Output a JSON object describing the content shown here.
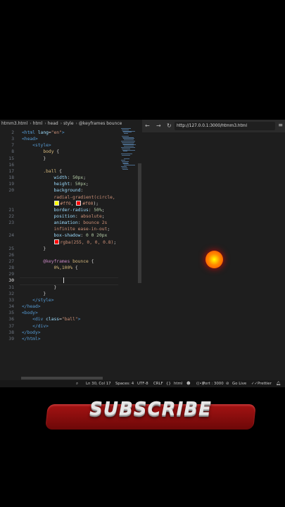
{
  "editor": {
    "breadcrumb": [
      "htmm3.html",
      "html",
      "head",
      "style",
      "@keyframes bounce"
    ],
    "lines": [
      {
        "n": "2",
        "segments": [
          [
            "tag",
            "<html "
          ],
          [
            "attr",
            "lang"
          ],
          [
            "plain",
            "="
          ],
          [
            "str",
            "\"en\""
          ],
          [
            "tag",
            ">"
          ]
        ]
      },
      {
        "n": "3",
        "segments": [
          [
            "tag",
            "<head>"
          ]
        ]
      },
      {
        "n": "7",
        "segments": [
          [
            "plain",
            "    "
          ],
          [
            "tag",
            "<style>"
          ]
        ]
      },
      {
        "n": "8",
        "segments": [
          [
            "plain",
            "        "
          ],
          [
            "sel",
            "body"
          ],
          [
            "plain",
            " {"
          ]
        ]
      },
      {
        "n": "15",
        "segments": [
          [
            "plain",
            "        }"
          ]
        ]
      },
      {
        "n": "16",
        "segments": [
          [
            "plain",
            ""
          ]
        ]
      },
      {
        "n": "17",
        "segments": [
          [
            "plain",
            "        "
          ],
          [
            "sel",
            ".ball"
          ],
          [
            "plain",
            " {"
          ]
        ]
      },
      {
        "n": "18",
        "segments": [
          [
            "plain",
            "            "
          ],
          [
            "prop",
            "width"
          ],
          [
            "plain",
            ": "
          ],
          [
            "num",
            "50px"
          ],
          [
            "plain",
            ";"
          ]
        ]
      },
      {
        "n": "19",
        "segments": [
          [
            "plain",
            "            "
          ],
          [
            "prop",
            "height"
          ],
          [
            "plain",
            ": "
          ],
          [
            "num",
            "50px"
          ],
          [
            "plain",
            ";"
          ]
        ]
      },
      {
        "n": "20",
        "segments": [
          [
            "plain",
            "            "
          ],
          [
            "prop",
            "background"
          ],
          [
            "plain",
            ":"
          ]
        ]
      },
      {
        "n": "",
        "segments": [
          [
            "plain",
            "            "
          ],
          [
            "val",
            "radial-gradient(circle,"
          ]
        ]
      },
      {
        "n": "",
        "segments": [
          [
            "plain",
            "            "
          ],
          [
            "swatchY",
            ""
          ],
          [
            "val",
            "#ff0"
          ],
          [
            "plain",
            ", "
          ],
          [
            "swatchR",
            ""
          ],
          [
            "val",
            "#f00"
          ],
          [
            "plain",
            ");"
          ]
        ]
      },
      {
        "n": "21",
        "segments": [
          [
            "plain",
            "            "
          ],
          [
            "prop",
            "border-radius"
          ],
          [
            "plain",
            ": "
          ],
          [
            "num",
            "50%"
          ],
          [
            "plain",
            ";"
          ]
        ]
      },
      {
        "n": "22",
        "segments": [
          [
            "plain",
            "            "
          ],
          [
            "prop",
            "position"
          ],
          [
            "plain",
            ": "
          ],
          [
            "val",
            "absolute"
          ],
          [
            "plain",
            ";"
          ]
        ]
      },
      {
        "n": "23",
        "segments": [
          [
            "plain",
            "            "
          ],
          [
            "prop",
            "animation"
          ],
          [
            "plain",
            ": "
          ],
          [
            "val",
            "bounce 2s"
          ]
        ]
      },
      {
        "n": "",
        "segments": [
          [
            "plain",
            "            "
          ],
          [
            "val",
            "infinite ease-in-out"
          ],
          [
            "plain",
            ";"
          ]
        ]
      },
      {
        "n": "24",
        "segments": [
          [
            "plain",
            "            "
          ],
          [
            "prop",
            "box-shadow"
          ],
          [
            "plain",
            ": "
          ],
          [
            "num",
            "0 0 20px"
          ]
        ]
      },
      {
        "n": "",
        "segments": [
          [
            "plain",
            "            "
          ],
          [
            "swatchR",
            ""
          ],
          [
            "val",
            "rgba(255, 0, 0, 0.8)"
          ],
          [
            "plain",
            ";"
          ]
        ]
      },
      {
        "n": "25",
        "segments": [
          [
            "plain",
            "        }"
          ]
        ]
      },
      {
        "n": "26",
        "segments": [
          [
            "plain",
            ""
          ]
        ]
      },
      {
        "n": "27",
        "segments": [
          [
            "plain",
            "        "
          ],
          [
            "kw",
            "@keyframes"
          ],
          [
            "plain",
            " "
          ],
          [
            "sel",
            "bounce"
          ],
          [
            "plain",
            " {"
          ]
        ]
      },
      {
        "n": "28",
        "segments": [
          [
            "plain",
            "            "
          ],
          [
            "sel",
            "0%,100%"
          ],
          [
            "plain",
            " {"
          ]
        ]
      },
      {
        "n": "29",
        "segments": [
          [
            "plain",
            ""
          ]
        ]
      },
      {
        "n": "30",
        "segments": [
          [
            "plain",
            ""
          ]
        ]
      },
      {
        "n": "31",
        "segments": [
          [
            "plain",
            "            }"
          ]
        ]
      },
      {
        "n": "32",
        "segments": [
          [
            "plain",
            "        }"
          ]
        ]
      },
      {
        "n": "33",
        "segments": [
          [
            "plain",
            "    "
          ],
          [
            "tag",
            "</style>"
          ]
        ]
      },
      {
        "n": "34",
        "segments": [
          [
            "tag",
            "</head>"
          ]
        ]
      },
      {
        "n": "35",
        "segments": [
          [
            "tag",
            "<body>"
          ]
        ]
      },
      {
        "n": "36",
        "segments": [
          [
            "plain",
            "    "
          ],
          [
            "tag",
            "<div "
          ],
          [
            "attr",
            "class"
          ],
          [
            "plain",
            "="
          ],
          [
            "str",
            "\"ball\""
          ],
          [
            "tag",
            ">"
          ]
        ]
      },
      {
        "n": "37",
        "segments": [
          [
            "plain",
            "    "
          ],
          [
            "tag",
            "</div>"
          ]
        ]
      },
      {
        "n": "38",
        "segments": [
          [
            "tag",
            "</body>"
          ]
        ]
      },
      {
        "n": "39",
        "segments": [
          [
            "tag",
            "</html>"
          ]
        ]
      }
    ],
    "active_line": "30"
  },
  "browser": {
    "back_icon": "←",
    "forward_icon": "→",
    "reload_icon": "↻",
    "menu_icon": "≡",
    "url": "http://127.0.0.1:3000/htmm3.html"
  },
  "statusbar": {
    "position": "Ln 30, Col 17",
    "spaces": "Spaces: 4",
    "encoding": "UTF-8",
    "eol": "CRLF",
    "language": "html",
    "port": "Port : 3000",
    "golive": "Go Live",
    "prettier": "Prettier"
  },
  "overlay": {
    "subscribe_text": "SUBSCRIBE"
  },
  "colors": {
    "ball_inner": "#ff0",
    "ball_outer": "#f00",
    "subscribe_red": "#a51313"
  }
}
